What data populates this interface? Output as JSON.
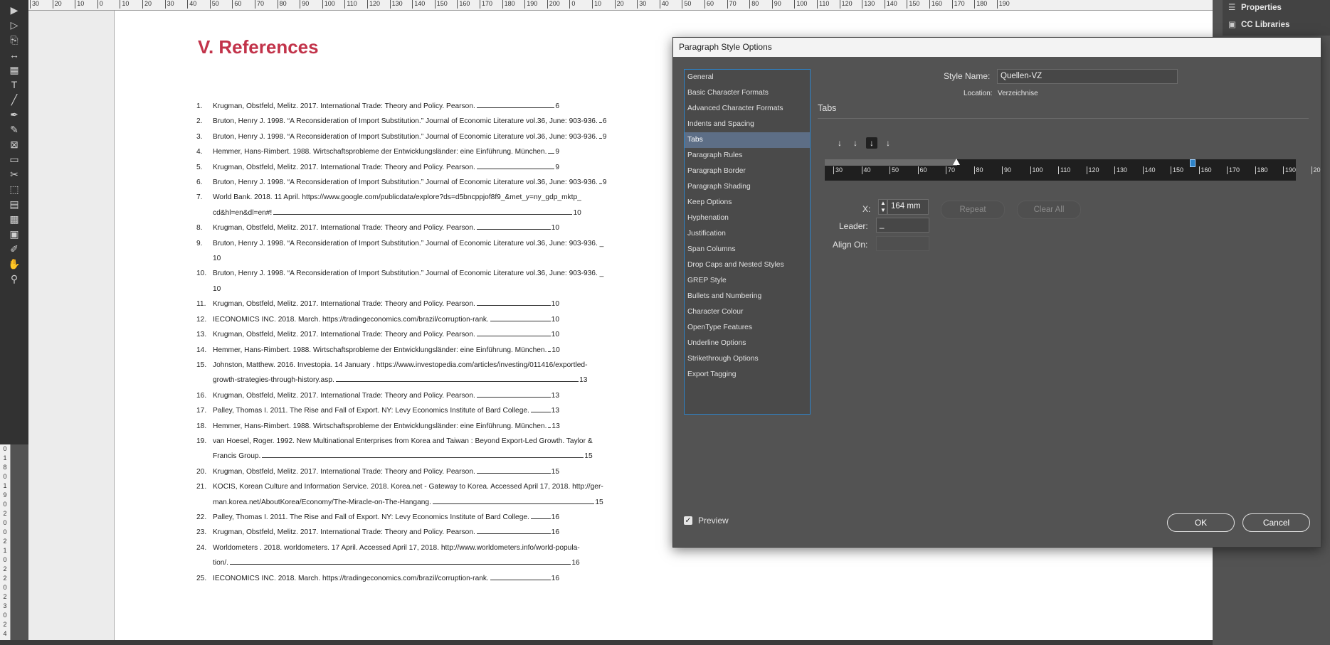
{
  "ruler": {
    "top_labels": [
      "30",
      "20",
      "10",
      "0",
      "10",
      "20",
      "30",
      "40",
      "50",
      "60",
      "70",
      "80",
      "90",
      "100",
      "110",
      "120",
      "130",
      "140",
      "150",
      "160",
      "170",
      "180",
      "190",
      "200",
      "0",
      "10",
      "20",
      "30",
      "40",
      "50",
      "60",
      "70",
      "80",
      "90",
      "100",
      "110",
      "120",
      "130",
      "140",
      "150",
      "160",
      "170",
      "180",
      "190"
    ],
    "left_labels": [
      "0",
      "1",
      "8",
      "0",
      "1",
      "9",
      "0",
      "2",
      "0",
      "0",
      "2",
      "1",
      "0",
      "2",
      "2",
      "0",
      "2",
      "3",
      "0",
      "2",
      "4"
    ]
  },
  "tools": {
    "icons": [
      "selection-tool-icon",
      "direct-selection-tool-icon",
      "page-tool-icon",
      "gap-tool-icon",
      "content-collector-icon",
      "type-tool-icon",
      "line-tool-icon",
      "pen-tool-icon",
      "pencil-tool-icon",
      "rectangle-frame-tool-icon",
      "rectangle-tool-icon",
      "scissors-tool-icon",
      "free-transform-tool-icon",
      "gradient-swatch-tool-icon",
      "gradient-feather-tool-icon",
      "note-tool-icon",
      "eyedropper-tool-icon",
      "hand-tool-icon",
      "zoom-tool-icon"
    ],
    "glyphs": [
      "▶",
      "▷",
      "⎘",
      "↔",
      "▦",
      "T",
      "╱",
      "✒",
      "✎",
      "⊠",
      "▭",
      "✂",
      "⬚",
      "▤",
      "▩",
      "▣",
      "✐",
      "✋",
      "⚲"
    ]
  },
  "document": {
    "heading": "V.  References",
    "references": [
      {
        "num": "1.",
        "lines": [
          {
            "text": "Krugman, Obstfeld, Melitz. 2017. International Trade: Theory and Policy. Pearson.",
            "page": "6"
          }
        ]
      },
      {
        "num": "2.",
        "lines": [
          {
            "text": "Bruton, Henry J. 1998. “A Reconsideration of Import Substitution.” Journal of Economic Literature vol.36, June: 903-936.",
            "page": "6"
          }
        ]
      },
      {
        "num": "3.",
        "lines": [
          {
            "text": "Bruton, Henry J. 1998. “A Reconsideration of Import Substitution.” Journal of Economic Literature vol.36, June: 903-936.",
            "page": "9"
          }
        ]
      },
      {
        "num": "4.",
        "lines": [
          {
            "text": "Hemmer, Hans-Rimbert. 1988. Wirtschaftsprobleme der Entwicklungsländer: eine Einführung. München.",
            "page": "9"
          }
        ]
      },
      {
        "num": "5.",
        "lines": [
          {
            "text": "Krugman, Obstfeld, Melitz. 2017. International Trade: Theory and Policy. Pearson.",
            "page": "9"
          }
        ]
      },
      {
        "num": "6.",
        "lines": [
          {
            "text": "Bruton, Henry J. 1998. “A Reconsideration of Import Substitution.” Journal of Economic Literature vol.36, June: 903-936.",
            "page": "9"
          }
        ]
      },
      {
        "num": "7.",
        "lines": [
          {
            "text": "World Bank. 2018. 11 April. https://www.google.com/publicdata/explore?ds=d5bncppjof8f9_&met_y=ny_gdp_mktp_",
            "page": ""
          },
          {
            "text": "cd&hl=en&dl=en#!",
            "page": "10"
          }
        ]
      },
      {
        "num": "8.",
        "lines": [
          {
            "text": "Krugman, Obstfeld, Melitz. 2017. International Trade: Theory and Policy. Pearson.",
            "page": "10"
          }
        ]
      },
      {
        "num": "9.",
        "lines": [
          {
            "text": "Bruton, Henry J. 1998. “A Reconsideration of Import Substitution.” Journal of Economic Literature vol.36, June: 903-936. _",
            "page": ""
          },
          {
            "text": "10",
            "page": ""
          }
        ]
      },
      {
        "num": "10.",
        "lines": [
          {
            "text": "Bruton, Henry J. 1998. “A Reconsideration of Import Substitution.” Journal of Economic Literature vol.36, June: 903-936. _",
            "page": ""
          },
          {
            "text": "10",
            "page": ""
          }
        ]
      },
      {
        "num": "11.",
        "lines": [
          {
            "text": "Krugman, Obstfeld, Melitz. 2017. International Trade: Theory and Policy. Pearson.",
            "page": "10"
          }
        ]
      },
      {
        "num": "12.",
        "lines": [
          {
            "text": "IECONOMICS INC. 2018. March. https://tradingeconomics.com/brazil/corruption-rank.",
            "page": "10"
          }
        ]
      },
      {
        "num": "13.",
        "lines": [
          {
            "text": "Krugman, Obstfeld, Melitz. 2017. International Trade: Theory and Policy. Pearson.",
            "page": "10"
          }
        ]
      },
      {
        "num": "14.",
        "lines": [
          {
            "text": "Hemmer, Hans-Rimbert. 1988. Wirtschaftsprobleme der Entwicklungsländer: eine Einführung. München.",
            "page": "10"
          }
        ]
      },
      {
        "num": "15.",
        "lines": [
          {
            "text": "Johnston, Matthew. 2016. Investopia. 14 January . https://www.investopedia.com/articles/investing/011416/exportled-",
            "page": ""
          },
          {
            "text": "growth-strategies-through-history.asp.",
            "page": "13"
          }
        ]
      },
      {
        "num": "16.",
        "lines": [
          {
            "text": "Krugman, Obstfeld, Melitz. 2017. International Trade: Theory and Policy. Pearson.",
            "page": "13"
          }
        ]
      },
      {
        "num": "17.",
        "lines": [
          {
            "text": "Palley, Thomas I. 2011. The Rise and Fall of Export. NY: Levy Economics Institute of Bard College.",
            "page": "13"
          }
        ]
      },
      {
        "num": "18.",
        "lines": [
          {
            "text": "Hemmer, Hans-Rimbert. 1988. Wirtschaftsprobleme der Entwicklungsländer: eine Einführung. München.",
            "page": "13"
          }
        ]
      },
      {
        "num": "19.",
        "lines": [
          {
            "text": "van Hoesel, Roger. 1992. New Multinational Enterprises from Korea and Taiwan : Beyond Export-Led Growth. Taylor &",
            "page": ""
          },
          {
            "text": "Francis Group.",
            "page": "15"
          }
        ]
      },
      {
        "num": "20.",
        "lines": [
          {
            "text": "Krugman, Obstfeld, Melitz. 2017. International Trade: Theory and Policy. Pearson.",
            "page": "15"
          }
        ]
      },
      {
        "num": "21.",
        "lines": [
          {
            "text": "KOCIS, Korean Culture and Information Service. 2018. Korea.net - Gateway to Korea. Accessed April 17, 2018. http://ger-",
            "page": ""
          },
          {
            "text": "man.korea.net/AboutKorea/Economy/The-Miracle-on-The-Hangang.",
            "page": "15"
          }
        ]
      },
      {
        "num": "22.",
        "lines": [
          {
            "text": "Palley, Thomas I. 2011. The Rise and Fall of Export. NY: Levy Economics Institute of Bard College.",
            "page": "16"
          }
        ]
      },
      {
        "num": "23.",
        "lines": [
          {
            "text": "Krugman, Obstfeld, Melitz. 2017. International Trade: Theory and Policy. Pearson.",
            "page": "16"
          }
        ]
      },
      {
        "num": "24.",
        "lines": [
          {
            "text": "Worldometers . 2018. worldometers. 17 April. Accessed April 17, 2018. http://www.worldometers.info/world-popula-",
            "page": ""
          },
          {
            "text": "tion/.",
            "page": "16"
          }
        ]
      },
      {
        "num": "25.",
        "lines": [
          {
            "text": "IECONOMICS INC. 2018. March. https://tradingeconomics.com/brazil/corruption-rank.",
            "page": "16"
          }
        ]
      }
    ]
  },
  "panels": {
    "properties_label": "Properties",
    "cc_libraries_label": "CC Libraries"
  },
  "dialog": {
    "title": "Paragraph Style Options",
    "categories": [
      "General",
      "Basic Character Formats",
      "Advanced Character Formats",
      "Indents and Spacing",
      "Tabs",
      "Paragraph Rules",
      "Paragraph Border",
      "Paragraph Shading",
      "Keep Options",
      "Hyphenation",
      "Justification",
      "Span Columns",
      "Drop Caps and Nested Styles",
      "GREP Style",
      "Bullets and Numbering",
      "Character Colour",
      "OpenType Features",
      "Underline Options",
      "Strikethrough Options",
      "Export Tagging"
    ],
    "selected_category": "Tabs",
    "style_name_label": "Style Name:",
    "style_name_value": "Quellen-VZ",
    "location_label": "Location:",
    "location_value": "Verzeichnise",
    "section_title": "Tabs",
    "tab_ruler_labels": [
      "30",
      "40",
      "50",
      "60",
      "70",
      "80",
      "90",
      "100",
      "110",
      "120",
      "130",
      "140",
      "150",
      "160",
      "170",
      "180",
      "190",
      "20"
    ],
    "x_label": "X:",
    "x_value": "164 mm",
    "leader_label": "Leader:",
    "leader_value": "_",
    "align_on_label": "Align On:",
    "align_on_value": "",
    "repeat_label": "Repeat",
    "clear_all_label": "Clear All",
    "preview_label": "Preview",
    "preview_checked": true,
    "ok_label": "OK",
    "cancel_label": "Cancel"
  }
}
